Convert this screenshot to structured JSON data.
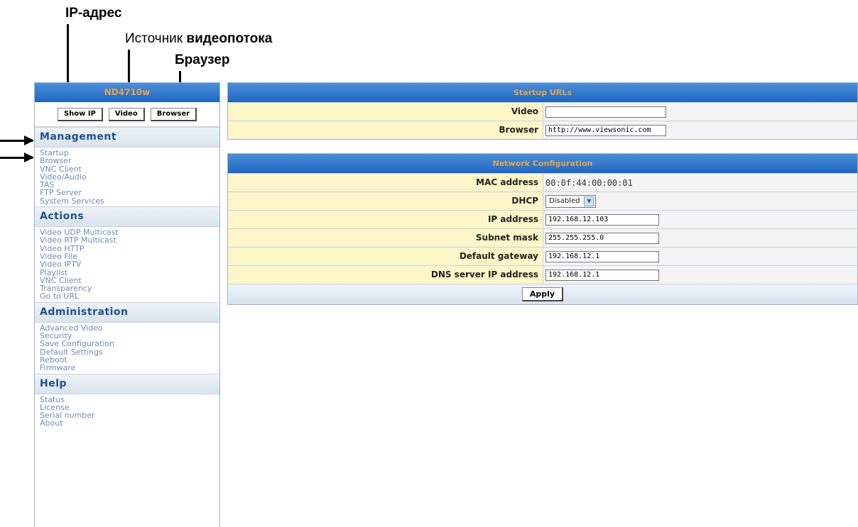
{
  "annotations": {
    "ip": "IP-адрес",
    "video_prefix": "Источник ",
    "video_bold": "видеопотока",
    "browser": "Браузер"
  },
  "sidebar": {
    "title": "ND4710w",
    "buttons": {
      "show_ip": "Show IP",
      "video": "Video",
      "browser": "Browser"
    },
    "sections": [
      {
        "title": "Management",
        "items": [
          "Startup",
          "Browser",
          "VNC Client",
          "Video/Audio",
          "TAS",
          "FTP Server",
          "System Services"
        ]
      },
      {
        "title": "Actions",
        "items": [
          "Video UDP Multicast",
          "Video RTP Multicast",
          "Video HTTP",
          "Video File",
          "Video IPTV",
          "Playlist",
          "VNC Client",
          "Transparency",
          "Go to URL"
        ]
      },
      {
        "title": "Administration",
        "items": [
          "Advanced Video",
          "Security",
          "Save Configuration",
          "Default Settings",
          "Reboot",
          "Firmware"
        ]
      },
      {
        "title": "Help",
        "items": [
          "Status",
          "License",
          "Serial number",
          "About"
        ]
      }
    ]
  },
  "startup": {
    "title": "Startup URLs",
    "video_label": "Video",
    "video_value": "",
    "browser_label": "Browser",
    "browser_value": "http://www.viewsonic.com"
  },
  "network": {
    "title": "Network Configuration",
    "mac_label": "MAC address",
    "mac_value": "00:0f:44:00:00:01",
    "dhcp_label": "DHCP",
    "dhcp_value": "Disabled",
    "ip_label": "IP address",
    "ip_value": "192.168.12.103",
    "subnet_label": "Subnet mask",
    "subnet_value": "255.255.255.0",
    "gateway_label": "Default gateway",
    "gateway_value": "192.168.12.1",
    "dns_label": "DNS server IP address",
    "dns_value": "192.168.12.1",
    "apply_label": "Apply"
  }
}
